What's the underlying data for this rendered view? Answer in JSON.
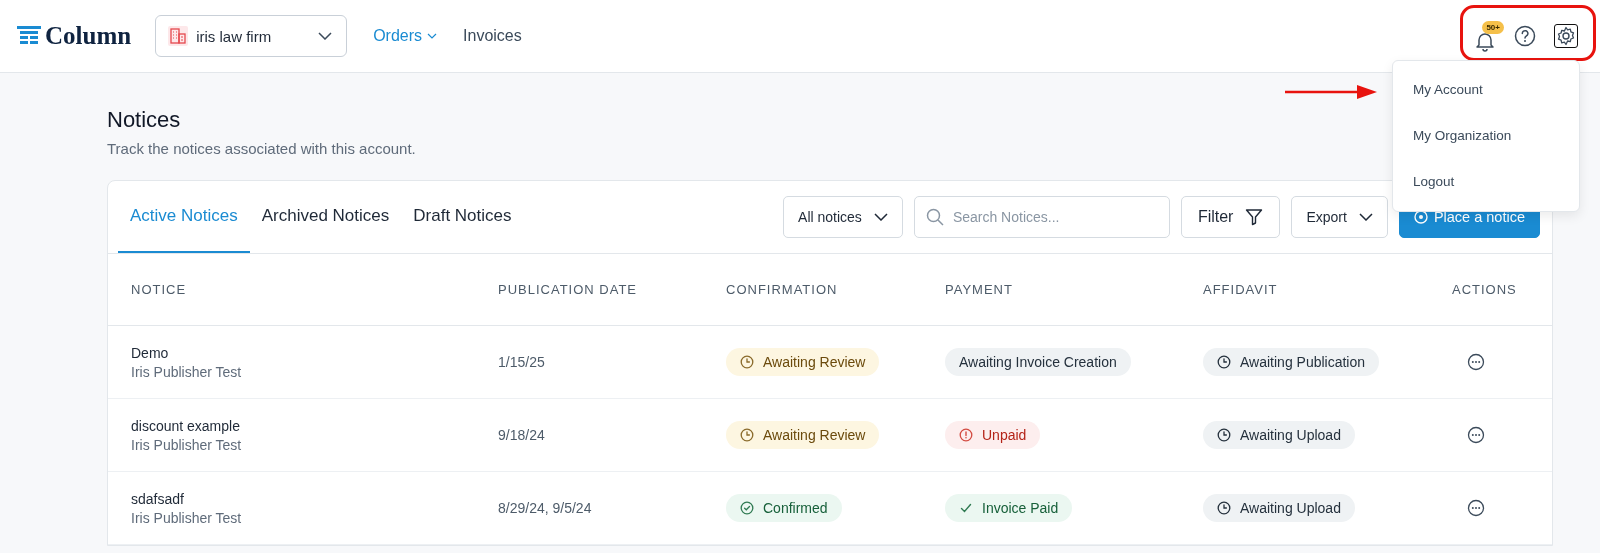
{
  "header": {
    "logo": "Column",
    "organization": "iris law firm",
    "nav": [
      {
        "label": "Orders",
        "selected": true,
        "has_menu": true
      },
      {
        "label": "Invoices",
        "selected": false,
        "has_menu": false
      }
    ],
    "notification_badge": "50+"
  },
  "account_menu": {
    "items": [
      "My Account",
      "My Organization",
      "Logout"
    ]
  },
  "page": {
    "title": "Notices",
    "subtitle": "Track the notices associated with this account."
  },
  "tabs": [
    {
      "label": "Active Notices",
      "selected": true
    },
    {
      "label": "Archived Notices",
      "selected": false
    },
    {
      "label": "Draft Notices",
      "selected": false
    }
  ],
  "toolbar": {
    "view_select": "All notices",
    "search": {
      "placeholder": "Search Notices..."
    },
    "filter": "Filter",
    "export": "Export",
    "primary": "Place a notice"
  },
  "table": {
    "columns": [
      "NOTICE",
      "PUBLICATION DATE",
      "CONFIRMATION",
      "PAYMENT",
      "AFFIDAVIT",
      "ACTIONS"
    ],
    "rows": [
      {
        "notice": "Demo",
        "publisher": "Iris Publisher Test",
        "publication_date": "1/15/25",
        "confirmation": {
          "text": "Awaiting Review",
          "kind": "review"
        },
        "payment": {
          "text": "Awaiting Invoice Creation",
          "kind": "plain"
        },
        "affidavit": {
          "text": "Awaiting Publication",
          "kind": "waiting"
        }
      },
      {
        "notice": "discount example",
        "publisher": "Iris Publisher Test",
        "publication_date": "9/18/24",
        "confirmation": {
          "text": "Awaiting Review",
          "kind": "review"
        },
        "payment": {
          "text": "Unpaid",
          "kind": "unpaid"
        },
        "affidavit": {
          "text": "Awaiting Upload",
          "kind": "waiting"
        }
      },
      {
        "notice": "sdafsadf",
        "publisher": "Iris Publisher Test",
        "publication_date": "8/29/24, 9/5/24",
        "confirmation": {
          "text": "Confirmed",
          "kind": "confirmed"
        },
        "payment": {
          "text": "Invoice Paid",
          "kind": "paid"
        },
        "affidavit": {
          "text": "Awaiting Upload",
          "kind": "waiting"
        }
      }
    ]
  }
}
